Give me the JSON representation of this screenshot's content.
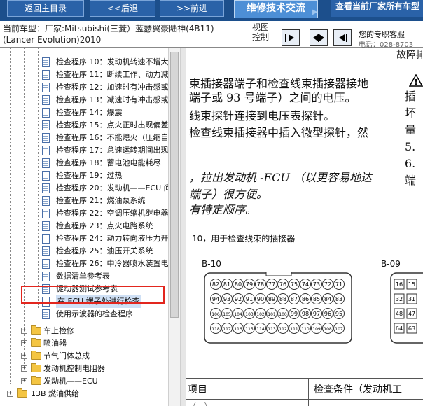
{
  "nav": {
    "home": "返回主目录",
    "back": "<<后退",
    "forward": ">>前进",
    "forum": "维修技术交流",
    "query": "查看当前厂家所有车型"
  },
  "header": {
    "car_line1": "当前车型：厂家:Mitsubishi(三菱）蓝瑟翼豪陆神(4B11)",
    "car_line2": "(Lancer Evolution)2010",
    "view_label_line1": "视图",
    "view_label_line2": "控制",
    "support_line1": "您的专职客服",
    "support_line2": "电话：028-8703"
  },
  "tree": {
    "doc_items": [
      "检查程序 10：发动机转速不增大",
      "检查程序 11：断续工作、动力减",
      "检查程序 12：加速时有冲击感或",
      "检查程序 13：减速时有冲击感或",
      "检查程序 14：爆震",
      "检查程序 15：点火正时出现偏差",
      "检查程序 16：不能熄火（压缩自",
      "检查程序 17：怠速运转期间出现",
      "检查程序 18：蓄电池电能耗尽",
      "检查程序 19：过热",
      "检查程序 20：发动机——ECU 间",
      "检查程序 21：燃油泵系统",
      "检查程序 22：空调压缩机继电器",
      "检查程序 23：点火电路系统",
      "检查程序 24：动力转向液压力开",
      "检查程序 25：油压开关系统",
      "检查程序 26：中冷器喷水装置电",
      "数据清单参考表",
      "促动器测试参考表",
      "在 ECU 端子处进行检查",
      "使用示波器的检查程序"
    ],
    "selected_index": 19,
    "folders": [
      "车上检修",
      "喷油器",
      "节气门体总成",
      "发动机控制电阻器",
      "发动机——ECU"
    ],
    "root_folder": "13B 燃油供给"
  },
  "doc": {
    "title": "故障排",
    "lines": [
      "束插接器端子和检查线束插接器接地",
      "端子或 93 号端子）之间的电压。",
      "线束探针连接到电压表探针。",
      "检查线束插接器中插入微型探针，然",
      "，拉出发动机 -ECU （以更容易地达",
      "端子）很方便。",
      "有特定顺序。"
    ],
    "side_text": [
      "插",
      "坏",
      "量",
      "5.",
      "",
      "6.",
      "",
      "端"
    ],
    "caption": "10，用于检查线束的插接器",
    "connector_b10_label": "B-10",
    "connector_b09_label": "B-09",
    "b10_pins": [
      [
        "82",
        "81",
        "80",
        "79",
        "78",
        "77",
        "76",
        "75",
        "74",
        "73",
        "72",
        "71"
      ],
      [
        "94",
        "93",
        "92",
        "91",
        "90",
        "89",
        "88",
        "87",
        "86",
        "85",
        "84",
        "83"
      ],
      [
        "106",
        "105",
        "104",
        "103",
        "102",
        "101",
        "100",
        "99",
        "98",
        "97",
        "96",
        "95"
      ],
      [
        "118",
        "117",
        "116",
        "115",
        "114",
        "113",
        "112",
        "111",
        "110",
        "109",
        "108",
        "107"
      ]
    ],
    "b09_pins": [
      [
        "16",
        "15"
      ],
      [
        "32",
        "31"
      ],
      [
        "48",
        "47"
      ],
      [
        "64",
        "63"
      ]
    ],
    "table_header_item": "项目",
    "table_header_cond": "检查条件（发动机工",
    "table_row_partial": "（...）"
  },
  "colors": {
    "nav_bg": "#1c4f8c",
    "nav_btn": "#2a62a8",
    "forum_btn": "#4d8fd6",
    "highlight": "#e2261e",
    "folder": "#f4c542"
  }
}
